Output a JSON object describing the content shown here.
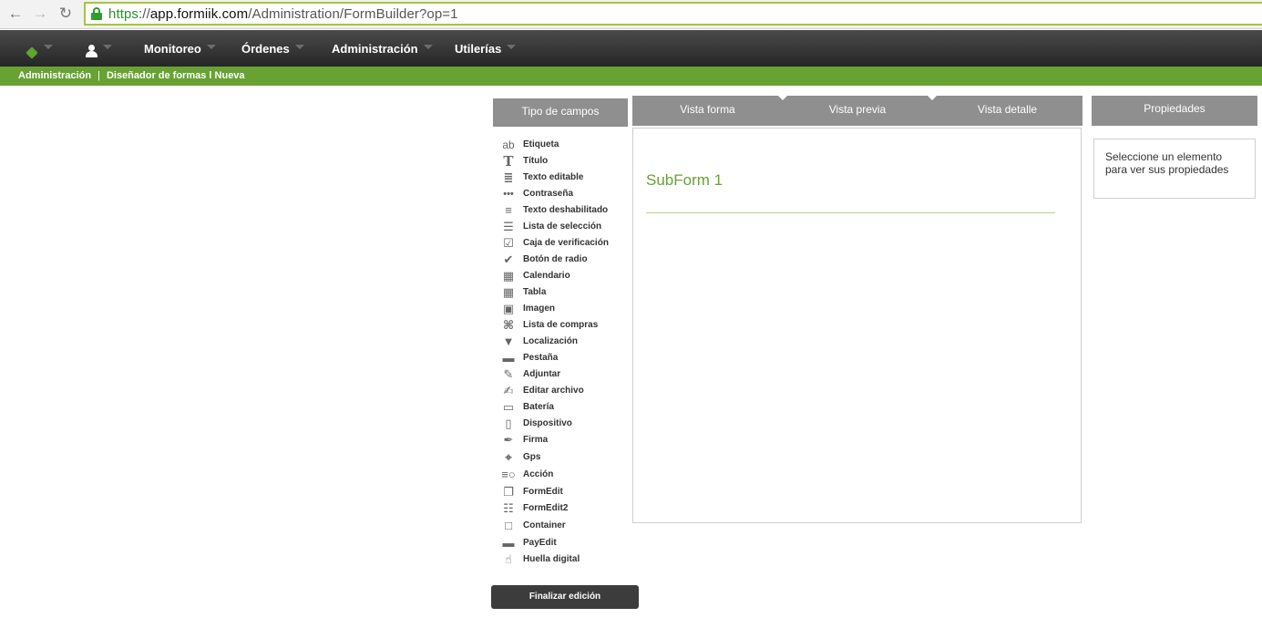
{
  "browser": {
    "url_scheme": "https",
    "url_sep": "://",
    "url_host": "app.formiik.com",
    "url_path": "/Administration/FormBuilder?op=1",
    "back_icon": "arrow-left-icon",
    "forward_icon": "arrow-right-icon",
    "reload_icon": "reload-icon",
    "secure_icon": "lock-icon"
  },
  "nav": {
    "logo_icon": "cube-logo-icon",
    "user_icon": "user-icon",
    "items": [
      {
        "label": "Monitoreo"
      },
      {
        "label": "Órdenes"
      },
      {
        "label": "Administración"
      },
      {
        "label": "Utilerías"
      }
    ]
  },
  "breadcrumb": {
    "root": "Administración",
    "separator": "|",
    "current": "Diseñador de formas l Nueva"
  },
  "field_types": {
    "title": "Tipo de campos",
    "items": [
      {
        "label": "Etiqueta",
        "icon": "text-label-icon"
      },
      {
        "label": "Título",
        "icon": "title-icon"
      },
      {
        "label": "Texto editable",
        "icon": "editable-text-icon"
      },
      {
        "label": "Contraseña",
        "icon": "password-icon"
      },
      {
        "label": "Texto deshabilitado",
        "icon": "disabled-text-icon"
      },
      {
        "label": "Lista de selección",
        "icon": "list-icon"
      },
      {
        "label": "Caja de verificación",
        "icon": "checkbox-icon"
      },
      {
        "label": "Botón de radio",
        "icon": "radio-icon"
      },
      {
        "label": "Calendario",
        "icon": "calendar-icon"
      },
      {
        "label": "Tabla",
        "icon": "table-icon"
      },
      {
        "label": "Imagen",
        "icon": "image-icon"
      },
      {
        "label": "Lista de compras",
        "icon": "cart-icon"
      },
      {
        "label": "Localización",
        "icon": "map-pin-icon"
      },
      {
        "label": "Pestaña",
        "icon": "folder-tab-icon"
      },
      {
        "label": "Adjuntar",
        "icon": "attach-icon"
      },
      {
        "label": "Editar archivo",
        "icon": "edit-file-icon"
      },
      {
        "label": "Batería",
        "icon": "battery-icon"
      },
      {
        "label": "Dispositivo",
        "icon": "device-icon"
      },
      {
        "label": "Firma",
        "icon": "signature-icon"
      },
      {
        "label": "Gps",
        "icon": "gps-icon"
      },
      {
        "label": "Acción",
        "icon": "action-icon"
      },
      {
        "label": "FormEdit",
        "icon": "form-edit-icon"
      },
      {
        "label": "FormEdit2",
        "icon": "form-edit2-icon"
      },
      {
        "label": "Container",
        "icon": "container-icon"
      },
      {
        "label": "PayEdit",
        "icon": "credit-card-icon"
      },
      {
        "label": "Huella digital",
        "icon": "fingerprint-icon"
      }
    ],
    "finish_label": "Finalizar edición"
  },
  "views": {
    "tabs": [
      {
        "label": "Vista forma"
      },
      {
        "label": "Vista previa"
      },
      {
        "label": "Vista detalle"
      }
    ]
  },
  "canvas": {
    "subform_title": "SubForm 1"
  },
  "properties": {
    "title": "Propiedades",
    "empty_message": "Seleccione un elemento para ver sus propiedades"
  },
  "colors": {
    "brand_green": "#67a233",
    "nav_dark": "#2b2b2b",
    "tab_gray": "#8f8f8f"
  }
}
